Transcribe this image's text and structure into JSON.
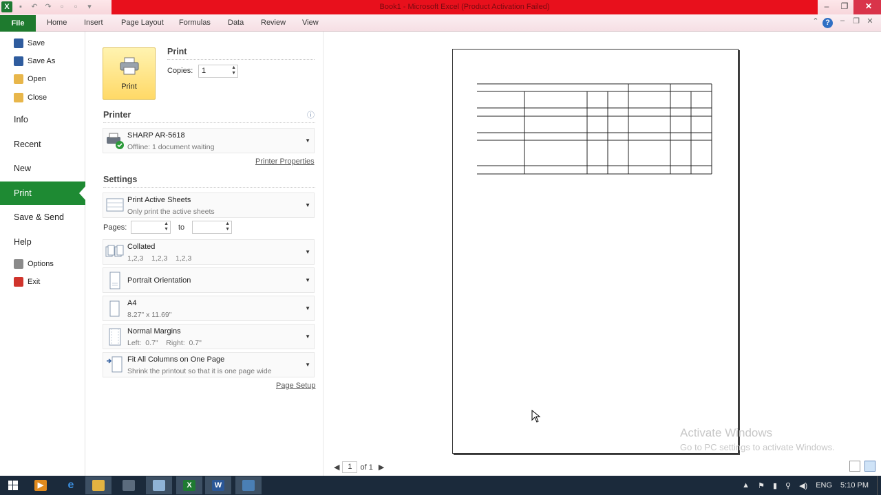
{
  "window": {
    "title": "Book1 - Microsoft Excel (Product Activation Failed)"
  },
  "ribbon": {
    "file_tab": "File",
    "tabs": [
      "Home",
      "Insert",
      "Page Layout",
      "Formulas",
      "Data",
      "Review",
      "View"
    ]
  },
  "nav": {
    "save": "Save",
    "save_as": "Save As",
    "open": "Open",
    "close": "Close",
    "info": "Info",
    "recent": "Recent",
    "new": "New",
    "print": "Print",
    "save_send": "Save & Send",
    "help": "Help",
    "options": "Options",
    "exit": "Exit"
  },
  "print": {
    "heading": "Print",
    "button_label": "Print",
    "copies_label": "Copies:",
    "copies_value": "1"
  },
  "printer": {
    "heading": "Printer",
    "name": "SHARP AR-5618",
    "status": "Offline: 1 document waiting",
    "properties_link": "Printer Properties"
  },
  "settings": {
    "heading": "Settings",
    "scope_main": "Print Active Sheets",
    "scope_sub": "Only print the active sheets",
    "pages_label": "Pages:",
    "pages_to": "to",
    "collate_main": "Collated",
    "collate_sub": "1,2,3    1,2,3    1,2,3",
    "orientation_main": "Portrait Orientation",
    "paper_main": "A4",
    "paper_sub": "8.27\" x 11.69\"",
    "margins_main": "Normal Margins",
    "margins_sub": "Left:  0.7\"    Right:  0.7\"",
    "scaling_main": "Fit All Columns on One Page",
    "scaling_sub": "Shrink the printout so that it is one page wide",
    "page_setup_link": "Page Setup"
  },
  "preview": {
    "current_page": "1",
    "of_pages": "of 1",
    "watermark_title": "Activate Windows",
    "watermark_sub": "Go to PC settings to activate Windows."
  },
  "taskbar": {
    "language": "ENG",
    "time": "5:10 PM"
  },
  "colors": {
    "accent_green": "#1e8a33",
    "title_red": "#e8101c"
  }
}
